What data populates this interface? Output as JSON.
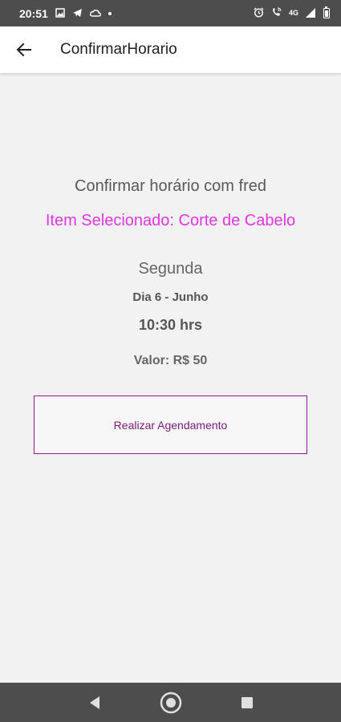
{
  "status_bar": {
    "time": "20:51",
    "network": "4G",
    "icons_left": [
      "gallery-icon",
      "telegram-icon",
      "cloud-icon",
      "dot-icon"
    ],
    "icons_right": [
      "alarm-icon",
      "wifi-call-icon",
      "signal-icon",
      "battery-icon"
    ]
  },
  "app_bar": {
    "title": "ConfirmarHorario",
    "back_icon": "arrow-left-icon"
  },
  "content": {
    "confirm_title": "Confirmar horário com fred",
    "selected_item": "Item Selecionado: Corte de Cabelo",
    "weekday": "Segunda",
    "date": "Dia 6 - Junho",
    "time": "10:30 hrs",
    "price": "Valor: R$ 50",
    "schedule_button_label": "Realizar Agendamento"
  },
  "nav_bar": {
    "back": "triangle-back-icon",
    "home": "circle-home-icon",
    "recents": "square-recents-icon"
  },
  "colors": {
    "accent_pink": "#e535e6",
    "button_border": "#8a1c8a",
    "bar_dark": "#4d4d4d",
    "background": "#f2f2f2"
  }
}
